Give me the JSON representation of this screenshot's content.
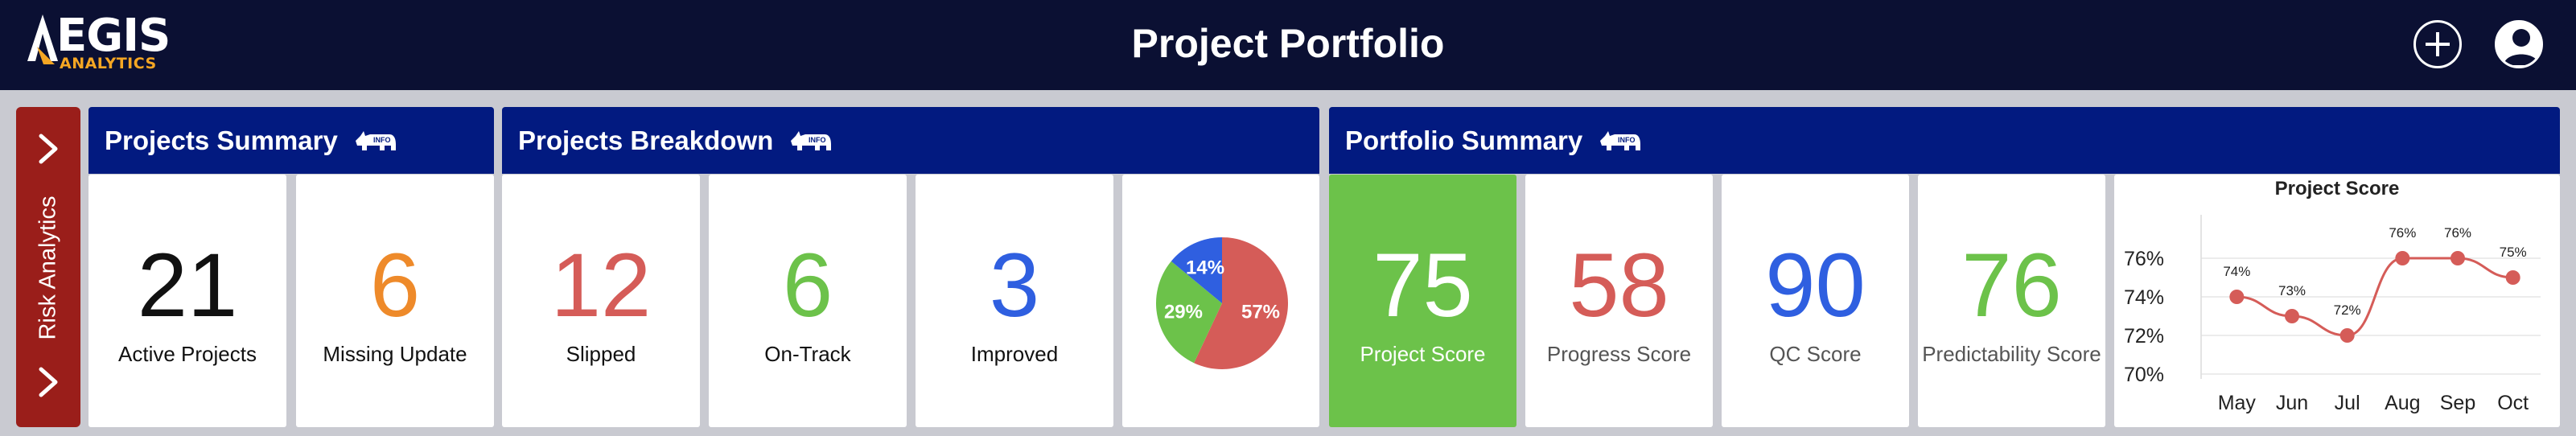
{
  "header": {
    "logo_main": "EGIS",
    "logo_sub": "ANALYTICS",
    "title": "Project Portfolio",
    "add_icon": "plus-icon",
    "user_icon": "user-avatar-icon"
  },
  "sidebar": {
    "label": "Risk Analytics",
    "expand_icon": "chevron-right-icon"
  },
  "panels": {
    "summary": {
      "title": "Projects Summary",
      "info_icon": "rhino-info-icon"
    },
    "breakdown": {
      "title": "Projects Breakdown",
      "info_icon": "rhino-info-icon"
    },
    "portfolio": {
      "title": "Portfolio Summary",
      "info_icon": "rhino-info-icon"
    }
  },
  "cards": {
    "active": {
      "value": "21",
      "label": "Active Projects",
      "color": "#111111"
    },
    "missing": {
      "value": "6",
      "label": "Missing Update",
      "color": "#ee8a2a"
    },
    "slipped": {
      "value": "12",
      "label": "Slipped",
      "color": "#d55c58"
    },
    "ontrack": {
      "value": "6",
      "label": "On-Track",
      "color": "#6cc24a"
    },
    "improved": {
      "value": "3",
      "label": "Improved",
      "color": "#2f5fe0"
    },
    "project_score": {
      "value": "75",
      "label": "Project Score",
      "color": "#ffffff"
    },
    "progress_score": {
      "value": "58",
      "label": "Progress Score",
      "color": "#d55c58"
    },
    "qc_score": {
      "value": "90",
      "label": "QC Score",
      "color": "#2f5fe0"
    },
    "predictability_score": {
      "value": "76",
      "label": "Predictability Score",
      "color": "#6cc24a"
    }
  },
  "colors": {
    "header_bg": "#0b1033",
    "panel_header": "#021a80",
    "sidebar": "#9a1e1a",
    "green": "#6cc24a",
    "red": "#d55c58",
    "blue": "#2f5fe0",
    "orange": "#ee8a2a"
  },
  "chart_data": [
    {
      "type": "pie",
      "slices": [
        {
          "label": "57%",
          "value": 57,
          "color": "#d55c58"
        },
        {
          "label": "29%",
          "value": 29,
          "color": "#6cc24a"
        },
        {
          "label": "14%",
          "value": 14,
          "color": "#2f5fe0"
        }
      ]
    },
    {
      "type": "line",
      "title": "Project Score",
      "categories": [
        "May",
        "Jun",
        "Jul",
        "Aug",
        "Sep",
        "Oct"
      ],
      "series": [
        {
          "values": [
            74,
            73,
            72,
            76,
            76,
            75
          ],
          "labels": [
            "74%",
            "73%",
            "72%",
            "76%",
            "76%",
            "75%"
          ],
          "color": "#d55c58"
        }
      ],
      "yticks": [
        "70%",
        "72%",
        "74%",
        "76%"
      ],
      "ylim": [
        70,
        77
      ],
      "grid": true
    }
  ]
}
